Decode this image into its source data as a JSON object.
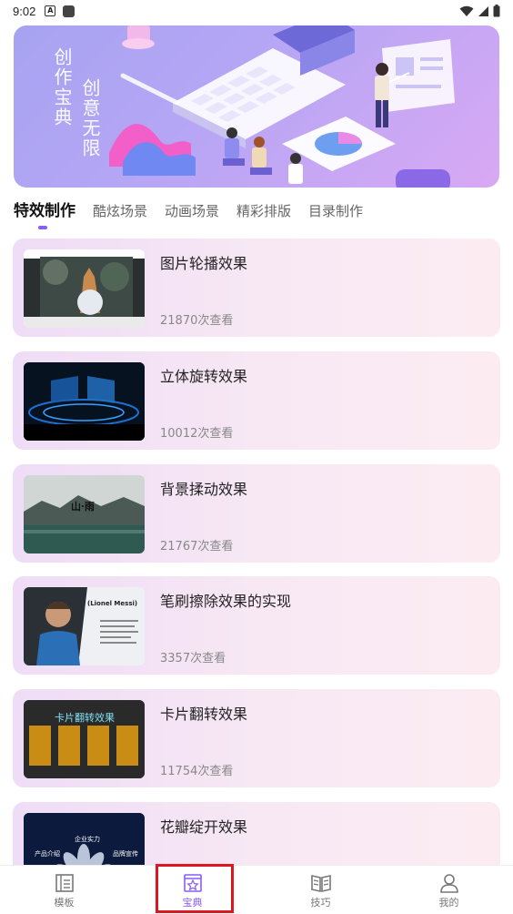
{
  "status_bar": {
    "time": "9:02"
  },
  "banner": {
    "text_col1": "创作宝典",
    "text_col2": "创意无限"
  },
  "tabs": [
    {
      "label": "特效制作",
      "active": true
    },
    {
      "label": "酷炫场景",
      "active": false
    },
    {
      "label": "动画场景",
      "active": false
    },
    {
      "label": "精彩排版",
      "active": false
    },
    {
      "label": "目录制作",
      "active": false
    }
  ],
  "items": [
    {
      "title": "图片轮播效果",
      "views": "21870次查看"
    },
    {
      "title": "立体旋转效果",
      "views": "10012次查看"
    },
    {
      "title": "背景揉动效果",
      "views": "21767次查看"
    },
    {
      "title": "笔刷擦除效果的实现",
      "views": "3357次查看"
    },
    {
      "title": "卡片翻转效果",
      "views": "11754次查看"
    },
    {
      "title": "花瓣绽开效果",
      "views": ""
    }
  ],
  "thumb_text": {
    "t3": "山·雨",
    "t4_title": "(Lionel Messi)",
    "t5_title": "卡片翻转效果",
    "t6_a": "企业实力",
    "t6_b": "产品介绍",
    "t6_c": "品牌宣传"
  },
  "bottom_nav": [
    {
      "label": "模板",
      "icon": "template-icon",
      "active": false
    },
    {
      "label": "宝典",
      "icon": "book-star-icon",
      "active": true
    },
    {
      "label": "技巧",
      "icon": "open-book-icon",
      "active": false
    },
    {
      "label": "我的",
      "icon": "user-icon",
      "active": false
    }
  ],
  "colors": {
    "accent": "#8b5cf6",
    "highlight": "#e0161e"
  }
}
